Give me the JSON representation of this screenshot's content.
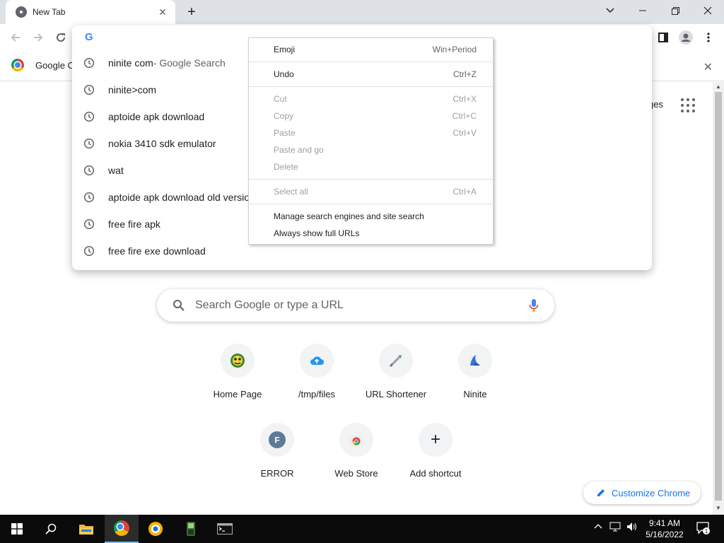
{
  "window": {
    "tab_title": "New Tab",
    "new_tab_symbol": "+",
    "close_symbol": "✕"
  },
  "bookmarks": {
    "item_label": "Google C"
  },
  "ntp": {
    "top_link_partial": "ges",
    "search_placeholder": "Search Google or type a URL",
    "shortcuts": [
      {
        "label": "Home Page",
        "icon": "home-page-icon"
      },
      {
        "label": "/tmp/files",
        "icon": "cloud-upload-icon"
      },
      {
        "label": "URL Shortener",
        "icon": "url-shortener-icon"
      },
      {
        "label": "Ninite",
        "icon": "ninite-icon"
      },
      {
        "label": "ERROR",
        "icon": "letter-f-icon",
        "letter": "F"
      },
      {
        "label": "Web Store",
        "icon": "web-store-icon"
      },
      {
        "label": "Add shortcut",
        "icon": "plus-icon",
        "symbol": "+"
      }
    ],
    "customize_label": "Customize Chrome"
  },
  "omnibox": {
    "g_letter": "G",
    "suggestions": [
      {
        "text": "ninite com",
        "sub": " - Google Search"
      },
      {
        "text": "ninite>com",
        "sub": ""
      },
      {
        "text": "aptoide apk download",
        "sub": ""
      },
      {
        "text": "nokia 3410 sdk emulator",
        "sub": ""
      },
      {
        "text": "wat",
        "sub": ""
      },
      {
        "text": "aptoide apk download old version",
        "sub": ""
      },
      {
        "text": "free fire apk",
        "sub": ""
      },
      {
        "text": "free fire exe download",
        "sub": ""
      }
    ]
  },
  "context_menu": {
    "items": [
      {
        "label": "Emoji",
        "shortcut": "Win+Period",
        "enabled": true
      },
      {
        "label": "Undo",
        "shortcut": "Ctrl+Z",
        "enabled": true
      },
      {
        "label": "Cut",
        "shortcut": "Ctrl+X",
        "enabled": false
      },
      {
        "label": "Copy",
        "shortcut": "Ctrl+C",
        "enabled": false
      },
      {
        "label": "Paste",
        "shortcut": "Ctrl+V",
        "enabled": false
      },
      {
        "label": "Paste and go",
        "shortcut": "",
        "enabled": false
      },
      {
        "label": "Delete",
        "shortcut": "",
        "enabled": false
      },
      {
        "label": "Select all",
        "shortcut": "Ctrl+A",
        "enabled": false
      },
      {
        "label": "Manage search engines and site search",
        "shortcut": "",
        "enabled": true
      },
      {
        "label": "Always show full URLs",
        "shortcut": "",
        "enabled": true
      }
    ]
  },
  "taskbar": {
    "time": "9:41 AM",
    "date": "5/16/2022",
    "notification_count": "1"
  },
  "colors": {
    "accent": "#1a73e8",
    "tabstrip": "#dee1e6",
    "taskbar": "#0b0b0b"
  }
}
